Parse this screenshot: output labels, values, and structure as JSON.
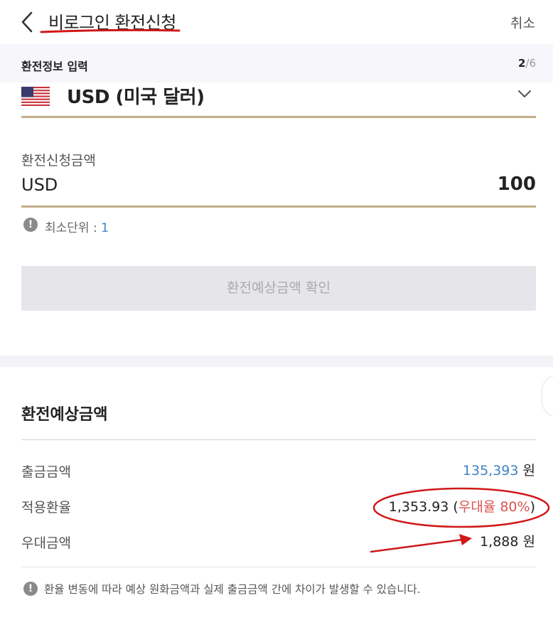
{
  "header": {
    "title": "비로그인 환전신청",
    "cancel_label": "취소"
  },
  "step": {
    "title": "환전정보 입력",
    "current": "2",
    "separator": "/",
    "total": "6"
  },
  "currency": {
    "flag": "us-flag-icon",
    "selected": "USD (미국 달러)"
  },
  "amount": {
    "label": "환전신청금액",
    "unit": "USD",
    "value": "100"
  },
  "min_unit": {
    "label": "최소단위 :",
    "value": "1"
  },
  "confirm_button_label": "환전예상금액 확인",
  "estimate": {
    "title": "환전예상금액",
    "rows": [
      {
        "label": "출금금액",
        "value": "135,393",
        "unit": "원"
      },
      {
        "label": "적용환율",
        "value": "1,353.93",
        "paren_open": "(",
        "discount": "우대율 80",
        "pct": "%",
        "paren_close": ")"
      },
      {
        "label": "우대금액",
        "value": "1,888",
        "unit": "원"
      }
    ],
    "notice": "환율 변동에 따라 예상 원화금액과 실제 출금금액 간에 차이가 발생할 수 있습니다."
  },
  "colors": {
    "accent_line": "#c3ae8a",
    "link_blue": "#3f82c4",
    "discount_red": "#d9534f",
    "annotation_red": "#d01818"
  }
}
